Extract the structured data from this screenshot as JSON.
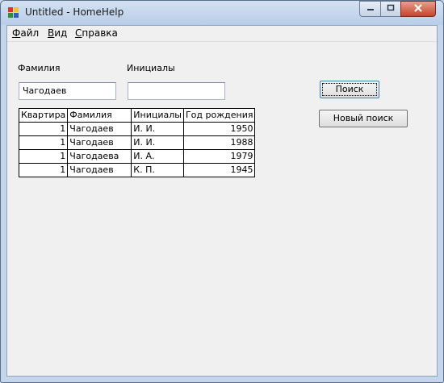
{
  "window": {
    "title": "Untitled - HomeHelp",
    "icons": {
      "app": "app-icon",
      "minimize": "minimize-icon",
      "maximize": "maximize-icon",
      "close": "close-icon"
    }
  },
  "menu": {
    "items": [
      {
        "underline": "Ф",
        "rest": "айл"
      },
      {
        "underline": "В",
        "rest": "ид"
      },
      {
        "underline": "С",
        "rest": "правка"
      }
    ]
  },
  "form": {
    "surname_label": "Фамилия",
    "initials_label": "Инициалы",
    "surname_value": "Чагодаев",
    "initials_value": "",
    "search_button": "Поиск",
    "new_search_button": "Новый поиск"
  },
  "table": {
    "headers": [
      "Квартира",
      "Фамилия",
      "Инициалы",
      "Год рождения"
    ],
    "rows": [
      [
        "1",
        "Чагодаев",
        "И. И.",
        "1950"
      ],
      [
        "1",
        "Чагодаев",
        "И. И.",
        "1988"
      ],
      [
        "1",
        "Чагодаева",
        "И. А.",
        "1979"
      ],
      [
        "1",
        "Чагодаев",
        "К. П.",
        "1945"
      ]
    ]
  }
}
